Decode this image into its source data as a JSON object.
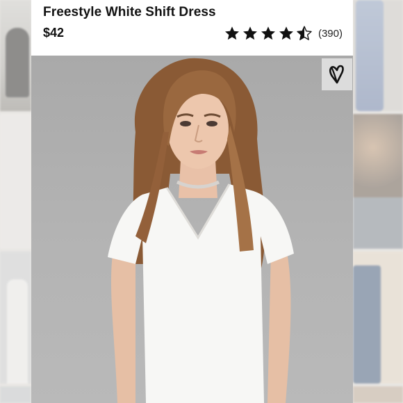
{
  "product": {
    "title": "Freestyle White Shift Dress",
    "price": "$42",
    "rating": {
      "stars": 4.5,
      "max": 5,
      "count_label": "(390)"
    }
  },
  "icons": {
    "favorite": "heart-outline-icon",
    "star_full": "star-icon",
    "star_half": "star-half-icon"
  },
  "colors": {
    "background": "#e9e7e4",
    "card": "#ffffff",
    "text": "#111111",
    "photo_bg": "#b0b0b0"
  }
}
